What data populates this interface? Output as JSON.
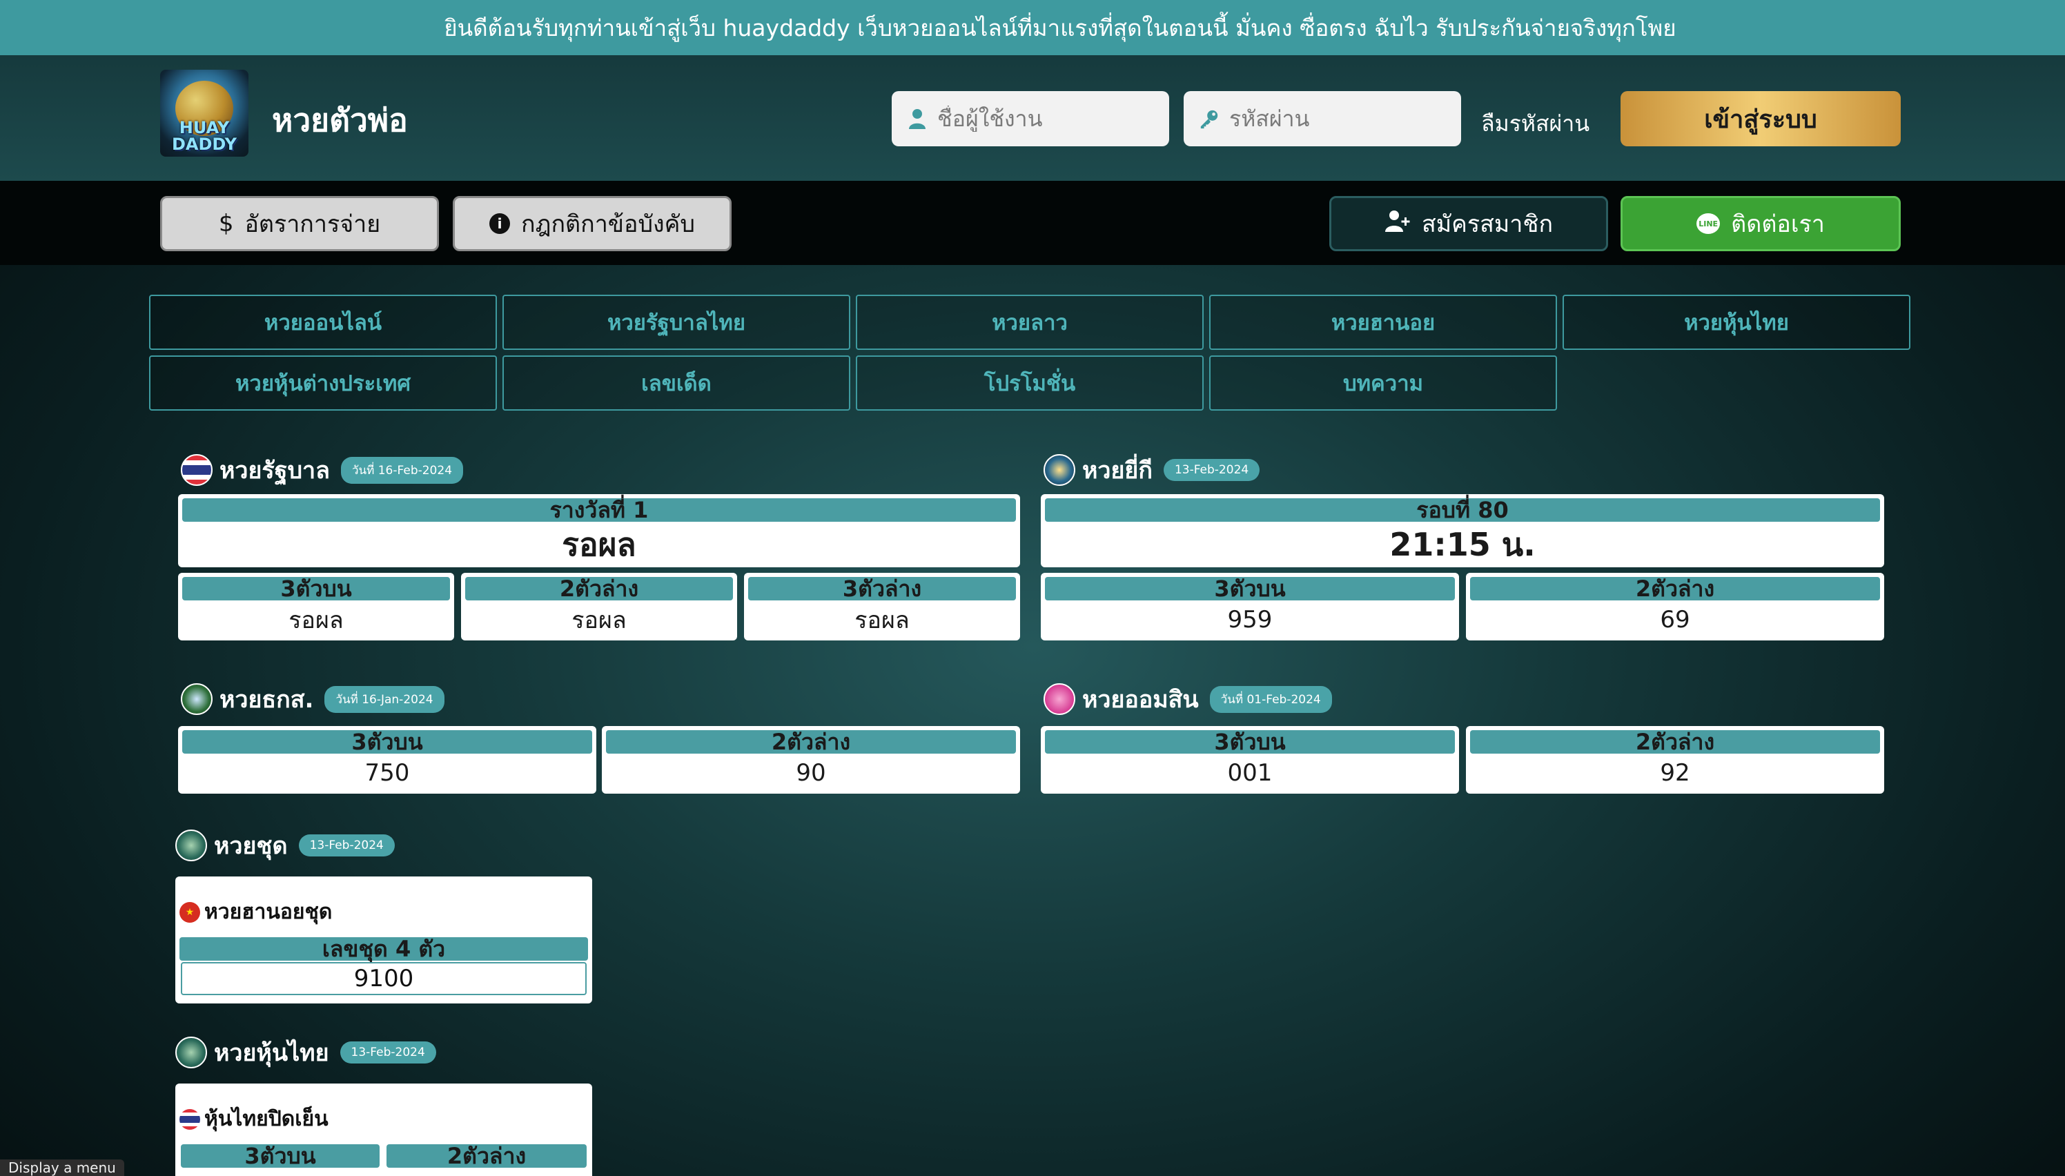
{
  "marquee": {
    "text": "ยินดีต้อนรับทุกท่านเข้าสู่เว็บ huaydaddy เว็บหวยออนไลน์ที่มาแรงที่สุดในตอนนี้ มั่นคง ซื่อตรง ฉับไว รับประกันจ่ายจริงทุกโพย"
  },
  "header": {
    "logo_text": "HUAY DADDY",
    "title": "หวยตัวพ่อ",
    "username_placeholder": "ชื่อผู้ใช้งาน",
    "password_placeholder": "รหัสผ่าน",
    "forgot_label": "ลืมรหัสผ่าน",
    "login_label": "เข้าสู่ระบบ"
  },
  "subnav": {
    "rates_label": "อัตราการจ่าย",
    "rules_label": "กฎกติกาข้อบังคับ",
    "register_label": "สมัครสมาชิก",
    "contact_label": "ติดต่อเรา",
    "rates_icon": "$",
    "rules_icon": "i",
    "line_icon": "LINE"
  },
  "categories": [
    "หวยออนไลน์",
    "หวยรัฐบาลไทย",
    "หวยลาว",
    "หวยฮานอย",
    "หวยหุ้นไทย",
    "หวยหุ้นต่างประเทศ",
    "เลขเด็ด",
    "โปรโมชั่น",
    "บทความ"
  ],
  "gov": {
    "title": "หวยรัฐบาล",
    "date": "วันที่ 16-Feb-2024",
    "main_label": "รางวัลที่ 1",
    "main_value": "รอผล",
    "cols": [
      {
        "label": "3ตัวบน",
        "value": "รอผล"
      },
      {
        "label": "2ตัวล่าง",
        "value": "รอผล"
      },
      {
        "label": "3ตัวล่าง",
        "value": "รอผล"
      }
    ]
  },
  "yeekee": {
    "title": "หวยยี่กี",
    "date": "13-Feb-2024",
    "main_label": "รอบที่ 80",
    "main_value": "21:15 น.",
    "cols": [
      {
        "label": "3ตัวบน",
        "value": "959"
      },
      {
        "label": "2ตัวล่าง",
        "value": "69"
      }
    ]
  },
  "baac": {
    "title": "หวยธกส.",
    "date": "วันที่ 16-Jan-2024",
    "cols": [
      {
        "label": "3ตัวบน",
        "value": "750"
      },
      {
        "label": "2ตัวล่าง",
        "value": "90"
      }
    ]
  },
  "gsb": {
    "title": "หวยออมสิน",
    "date": "วันที่ 01-Feb-2024",
    "cols": [
      {
        "label": "3ตัวบน",
        "value": "001"
      },
      {
        "label": "2ตัวล่าง",
        "value": "92"
      }
    ]
  },
  "set": {
    "title": "หวยชุด",
    "date": "13-Feb-2024",
    "item_title": "หวยฮานอยชุด",
    "label": "เลขชุด 4 ตัว",
    "value": "9100"
  },
  "stock": {
    "title": "หวยหุ้นไทย",
    "date": "13-Feb-2024",
    "item_title": "หุ้นไทยปิดเย็น",
    "cols": [
      {
        "label": "3ตัวบน"
      },
      {
        "label": "2ตัวล่าง"
      }
    ]
  },
  "status_tooltip": "Display a menu"
}
